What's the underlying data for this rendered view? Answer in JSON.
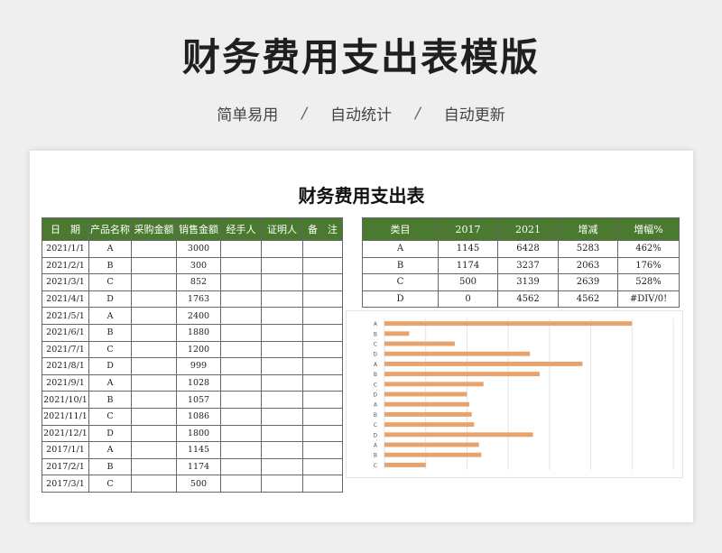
{
  "header": {
    "title": "财务费用支出表模版",
    "tags": [
      "简单易用",
      "自动统计",
      "自动更新"
    ],
    "separator": "/"
  },
  "sheet": {
    "title": "财务费用支出表",
    "left_headers": [
      "日　期",
      "产品名称",
      "采购金额",
      "销售金额",
      "经手人",
      "证明人",
      "备　注"
    ],
    "left_rows": [
      [
        "2021/1/1",
        "A",
        "",
        "3000",
        "",
        "",
        ""
      ],
      [
        "2021/2/1",
        "B",
        "",
        "300",
        "",
        "",
        ""
      ],
      [
        "2021/3/1",
        "C",
        "",
        "852",
        "",
        "",
        ""
      ],
      [
        "2021/4/1",
        "D",
        "",
        "1763",
        "",
        "",
        ""
      ],
      [
        "2021/5/1",
        "A",
        "",
        "2400",
        "",
        "",
        ""
      ],
      [
        "2021/6/1",
        "B",
        "",
        "1880",
        "",
        "",
        ""
      ],
      [
        "2021/7/1",
        "C",
        "",
        "1200",
        "",
        "",
        ""
      ],
      [
        "2021/8/1",
        "D",
        "",
        "999",
        "",
        "",
        ""
      ],
      [
        "2021/9/1",
        "A",
        "",
        "1028",
        "",
        "",
        ""
      ],
      [
        "2021/10/1",
        "B",
        "",
        "1057",
        "",
        "",
        ""
      ],
      [
        "2021/11/1",
        "C",
        "",
        "1086",
        "",
        "",
        ""
      ],
      [
        "2021/12/1",
        "D",
        "",
        "1800",
        "",
        "",
        ""
      ],
      [
        "2017/1/1",
        "A",
        "",
        "1145",
        "",
        "",
        ""
      ],
      [
        "2017/2/1",
        "B",
        "",
        "1174",
        "",
        "",
        ""
      ],
      [
        "2017/3/1",
        "C",
        "",
        "500",
        "",
        "",
        ""
      ]
    ],
    "right_headers": [
      "类目",
      "2017",
      "2021",
      "增减",
      "增幅%"
    ],
    "right_rows": [
      [
        "A",
        "1145",
        "6428",
        "5283",
        "462%"
      ],
      [
        "B",
        "1174",
        "3237",
        "2063",
        "176%"
      ],
      [
        "C",
        "500",
        "3139",
        "2639",
        "528%"
      ],
      [
        "D",
        "0",
        "4562",
        "4562",
        "#DIV/0!"
      ]
    ]
  },
  "colors": {
    "header_green": "#4a7a2f",
    "bar_orange": "#e8a36c"
  },
  "chart_data": {
    "type": "bar",
    "orientation": "horizontal",
    "categories": [
      "A",
      "B",
      "C",
      "D",
      "A",
      "B",
      "C",
      "D",
      "A",
      "B",
      "C",
      "D",
      "A",
      "B",
      "C"
    ],
    "values": [
      3000,
      300,
      852,
      1763,
      2400,
      1880,
      1200,
      999,
      1028,
      1057,
      1086,
      1800,
      1145,
      1174,
      500
    ],
    "xlim": [
      0,
      3500
    ],
    "grid": true,
    "legend": "none"
  }
}
